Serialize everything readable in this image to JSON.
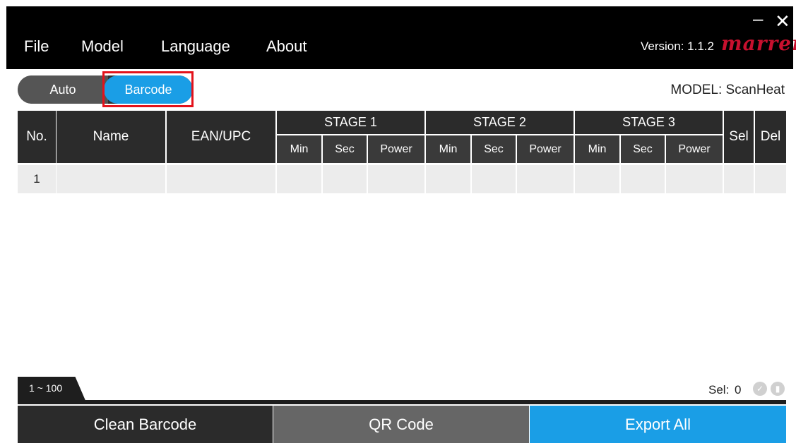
{
  "window": {
    "minimize": "–",
    "close": "✕"
  },
  "menu": {
    "items": [
      "File",
      "Model",
      "Language",
      "About"
    ]
  },
  "version": "Version: 1.1.2",
  "brand": "marren",
  "mode": {
    "auto_label": "Auto",
    "barcode_label": "Barcode",
    "active": "Barcode"
  },
  "model_label": "MODEL: ScanHeat",
  "table": {
    "headers": {
      "no": "No.",
      "name": "Name",
      "ean": "EAN/UPC",
      "sel": "Sel",
      "del": "Del"
    },
    "stages": [
      "STAGE 1",
      "STAGE 2",
      "STAGE 3"
    ],
    "stage_cols": [
      "Min",
      "Sec",
      "Power"
    ],
    "rows": [
      {
        "no": "1",
        "name": "",
        "ean": ""
      }
    ]
  },
  "pagination": {
    "tab": "1 ~ 100"
  },
  "selection": {
    "label": "Sel:",
    "count": "0"
  },
  "icons": {
    "confirm": "check-circle-icon",
    "delete": "trash-circle-icon"
  },
  "buttons": {
    "clean": "Clean Barcode",
    "qr": "QR Code",
    "export": "Export All"
  },
  "colors": {
    "accent": "#1a9ee6",
    "brand": "#c8102e",
    "highlight": "#e3121b"
  }
}
